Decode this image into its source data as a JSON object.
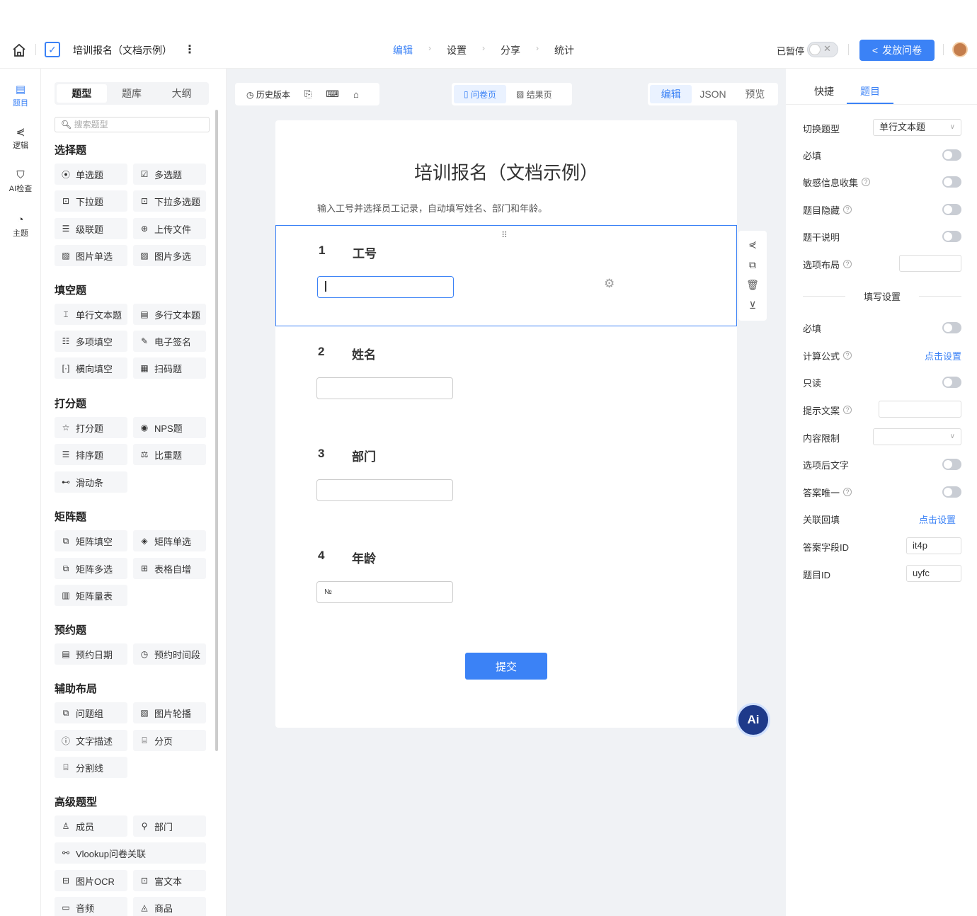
{
  "header": {
    "app_title": "培训报名（文档示例）",
    "steps": [
      "编辑",
      "设置",
      "分享",
      "统计"
    ],
    "active_step": "编辑",
    "paused_label": "已暂停",
    "publish_label": "发放问卷"
  },
  "rail": {
    "items": [
      {
        "label": "题目",
        "icon": "document-icon"
      },
      {
        "label": "逻辑",
        "icon": "logic-icon"
      },
      {
        "label": "AI检查",
        "icon": "shield-icon"
      },
      {
        "label": "主题",
        "icon": "palette-icon"
      }
    ]
  },
  "left_panel": {
    "tabs": [
      "题型",
      "题库",
      "大纲"
    ],
    "search_placeholder": "搜索题型",
    "sections": [
      {
        "title": "选择题",
        "items": [
          "单选题",
          "多选题",
          "下拉题",
          "下拉多选题",
          "级联题",
          "上传文件",
          "图片单选",
          "图片多选"
        ]
      },
      {
        "title": "填空题",
        "items": [
          "单行文本题",
          "多行文本题",
          "多项填空",
          "电子签名",
          "横向填空",
          "扫码题"
        ]
      },
      {
        "title": "打分题",
        "items": [
          "打分题",
          "NPS题",
          "排序题",
          "比重题",
          "滑动条"
        ]
      },
      {
        "title": "矩阵题",
        "items": [
          "矩阵填空",
          "矩阵单选",
          "矩阵多选",
          "表格自增",
          "矩阵量表"
        ]
      },
      {
        "title": "预约题",
        "items": [
          "预约日期",
          "预约时间段"
        ]
      },
      {
        "title": "辅助布局",
        "items": [
          "问题组",
          "图片轮播",
          "文字描述",
          "分页",
          "分割线"
        ]
      },
      {
        "title": "高级题型",
        "items": [
          "成员",
          "部门",
          "Vlookup问卷关联",
          "图片OCR",
          "富文本",
          "音频",
          "商品"
        ]
      }
    ]
  },
  "canvas": {
    "history_label": "历史版本",
    "page_tabs": [
      "问卷页",
      "结果页"
    ],
    "mode_tabs": [
      "编辑",
      "JSON",
      "预览"
    ],
    "form_title": "培训报名（文档示例）",
    "form_desc": "输入工号并选择员工记录，自动填写姓名、部门和年龄。",
    "questions": [
      {
        "num": "1",
        "label": "工号",
        "value": ""
      },
      {
        "num": "2",
        "label": "姓名",
        "value": ""
      },
      {
        "num": "3",
        "label": "部门",
        "value": ""
      },
      {
        "num": "4",
        "label": "年龄",
        "value": "№"
      }
    ],
    "submit_label": "提交",
    "ai_label": "Ai"
  },
  "right_panel": {
    "tabs": [
      "快捷",
      "题目"
    ],
    "switch_type_label": "切换题型",
    "switch_type_value": "单行文本题",
    "rows_top": [
      {
        "label": "必填",
        "help": false
      },
      {
        "label": "敏感信息收集",
        "help": true
      },
      {
        "label": "题目隐藏",
        "help": true
      },
      {
        "label": "题干说明",
        "help": false
      }
    ],
    "option_layout_label": "选项布局",
    "fill_settings_label": "填写设置",
    "required2_label": "必填",
    "formula_label": "计算公式",
    "formula_link": "点击设置",
    "readonly_label": "只读",
    "hint_label": "提示文案",
    "content_limit_label": "内容限制",
    "after_option_label": "选项后文字",
    "unique_label": "答案唯一",
    "backfill_label": "关联回填",
    "backfill_link": "点击设置",
    "field_id_label": "答案字段ID",
    "field_id_value": "it4p",
    "question_id_label": "题目ID",
    "question_id_value": "uyfc"
  }
}
